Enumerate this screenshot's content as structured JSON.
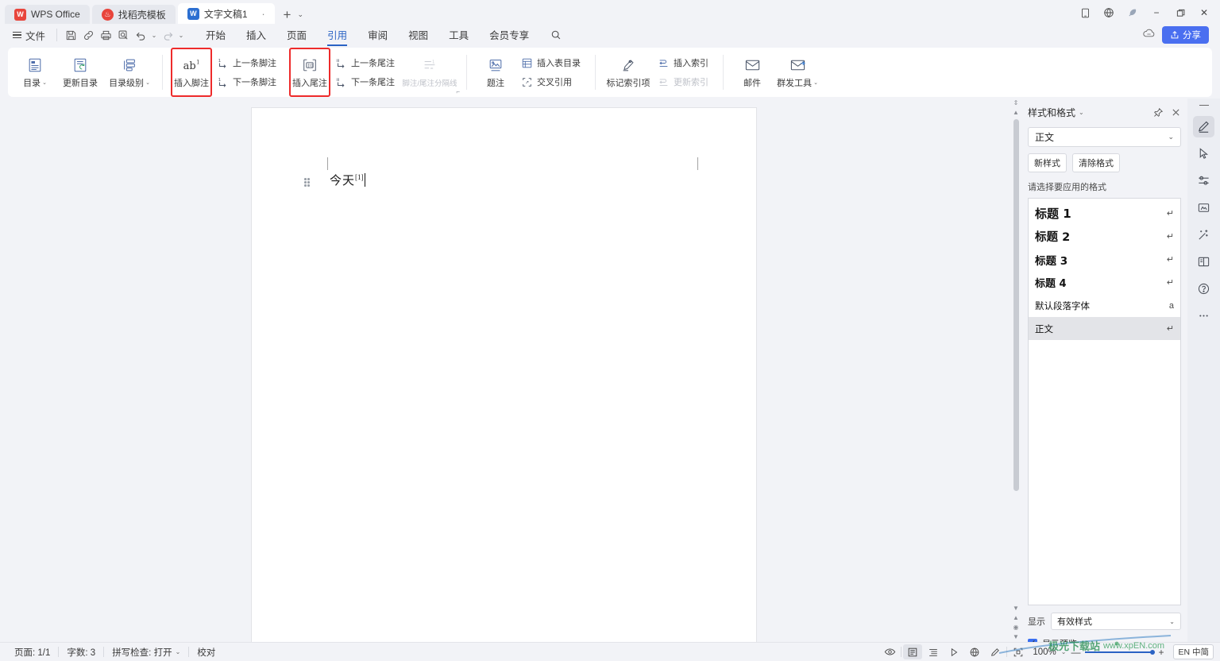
{
  "window": {
    "tabs": [
      {
        "icon": "wps-logo-icon",
        "label": "WPS Office",
        "kind": "wps"
      },
      {
        "icon": "template-icon",
        "label": "找稻壳模板",
        "kind": "tpl"
      },
      {
        "icon": "word-doc-icon",
        "label": "文字文稿1",
        "kind": "w",
        "active": true,
        "close": "✕"
      }
    ],
    "new_tab": "+",
    "new_tab_caret": "⌄",
    "right_icons": [
      "tablet-mode-icon",
      "globe-icon",
      "feather-icon"
    ],
    "minimize": "−",
    "restore": "❐",
    "close": "✕"
  },
  "menubar": {
    "file_label": "文件",
    "quick_access": [
      "save-icon",
      "link-icon",
      "print-icon",
      "print-preview-icon",
      "undo-icon",
      "redo-icon"
    ],
    "undo_caret": "⌄",
    "redo_caret": "⌄",
    "tabs": [
      {
        "label": "开始",
        "active": false
      },
      {
        "label": "插入",
        "active": false
      },
      {
        "label": "页面",
        "active": false
      },
      {
        "label": "引用",
        "active": true
      },
      {
        "label": "审阅",
        "active": false
      },
      {
        "label": "视图",
        "active": false
      },
      {
        "label": "工具",
        "active": false
      },
      {
        "label": "会员专享",
        "active": false
      }
    ],
    "search_icon": "search-icon",
    "cloud_icon": "cloud-sync-icon",
    "share_label": "分享",
    "share_icon": "share-icon",
    "share_color": "#4a6ff0"
  },
  "ribbon": {
    "highlight_color": "#ee2b2b",
    "groups": [
      {
        "name": "toc",
        "big": [
          {
            "label": "目录",
            "icon": "toc-icon",
            "caret": "⌄"
          },
          {
            "label": "更新目录",
            "icon": "update-toc-icon",
            "caret": ""
          },
          {
            "label": "目录级别",
            "icon": "toc-level-icon",
            "caret": "⌄"
          }
        ]
      },
      {
        "name": "footnote",
        "big": [
          {
            "label": "插入脚注",
            "icon": "insert-footnote-icon",
            "caret": "",
            "highlighted": true
          }
        ],
        "small": [
          {
            "label": "上一条脚注",
            "icon": "prev-footnote-icon",
            "disabled": false
          },
          {
            "label": "下一条脚注",
            "icon": "next-footnote-icon",
            "disabled": false
          }
        ]
      },
      {
        "name": "endnote",
        "big": [
          {
            "label": "插入尾注",
            "icon": "insert-endnote-icon",
            "caret": "",
            "highlighted": true
          }
        ],
        "small": [
          {
            "label": "上一条尾注",
            "icon": "prev-endnote-icon",
            "disabled": false
          },
          {
            "label": "下一条尾注",
            "icon": "next-endnote-icon",
            "disabled": false
          }
        ],
        "big2": [
          {
            "label": "脚注/尾注分隔线",
            "icon": "footnote-separator-icon",
            "caret": "",
            "disabled": true
          }
        ],
        "expander": "⌐"
      },
      {
        "name": "caption",
        "big": [
          {
            "label": "题注",
            "icon": "caption-icon",
            "caret": ""
          }
        ],
        "small": [
          {
            "label": "插入表目录",
            "icon": "insert-table-of-figures-icon",
            "disabled": false
          },
          {
            "label": "交叉引用",
            "icon": "cross-reference-icon",
            "disabled": false
          }
        ]
      },
      {
        "name": "index",
        "big": [
          {
            "label": "标记索引项",
            "icon": "mark-index-entry-icon",
            "caret": ""
          }
        ],
        "small": [
          {
            "label": "插入索引",
            "icon": "insert-index-icon",
            "disabled": false
          },
          {
            "label": "更新索引",
            "icon": "update-index-icon",
            "disabled": true
          }
        ]
      },
      {
        "name": "mail",
        "big": [
          {
            "label": "邮件",
            "icon": "mail-icon",
            "caret": ""
          },
          {
            "label": "群发工具",
            "icon": "mass-mail-icon",
            "caret": "⌄"
          }
        ]
      }
    ]
  },
  "document": {
    "text": "今天",
    "endnote_mark": "[1]",
    "paragraph_handle": "paragraph-drag-handle"
  },
  "styles_panel": {
    "title": "样式和格式",
    "title_caret": "⌄",
    "pin_icon": "pin-icon",
    "close_icon": "close-icon",
    "current_style": "正文",
    "current_style_caret": "⌄",
    "new_style_btn": "新样式",
    "clear_format_btn": "清除格式",
    "hint": "请选择要应用的格式",
    "items": [
      {
        "name": "标题",
        "num": "1",
        "mark": "↵",
        "class": "sh1",
        "selected": false
      },
      {
        "name": "标题",
        "num": "2",
        "mark": "↵",
        "class": "sh2",
        "selected": false
      },
      {
        "name": "标题",
        "num": "3",
        "mark": "↵",
        "class": "sh3",
        "selected": false
      },
      {
        "name": "标题",
        "num": "4",
        "mark": "↵",
        "class": "sh4",
        "selected": false
      },
      {
        "name": "默认段落字体",
        "num": "",
        "mark": "a",
        "class": "sbody",
        "selected": false
      },
      {
        "name": "正文",
        "num": "",
        "mark": "↵",
        "class": "sbody",
        "selected": true
      }
    ],
    "show_label": "显示",
    "show_value": "有效样式",
    "show_caret": "⌄",
    "preview_label": "显示预览",
    "preview_checked": true
  },
  "rail": {
    "items": [
      {
        "icon": "pen-highlight-icon",
        "active": true
      },
      {
        "icon": "cursor-select-icon",
        "active": false
      },
      {
        "icon": "settings-slider-icon",
        "active": false
      },
      {
        "icon": "document-tools-icon",
        "active": false
      },
      {
        "icon": "magic-wand-icon",
        "active": false
      },
      {
        "icon": "book-reader-icon",
        "active": false
      },
      {
        "icon": "help-circle-icon",
        "active": false
      },
      {
        "icon": "more-dots-icon",
        "active": false
      }
    ]
  },
  "statusbar": {
    "page_label": "页面: 1/1",
    "word_count": "字数: 3",
    "spellcheck": "拼写检查: 打开",
    "spellcheck_caret": "⌄",
    "proofread": "校对",
    "view_icons": [
      "eye-icon",
      "print-layout-icon",
      "outline-view-icon",
      "reading-layout-icon",
      "web-layout-icon",
      "edit-pen-icon",
      "focus-mode-icon"
    ],
    "zoom": "100%",
    "zoom_caret": "⌄",
    "zoom_minus": "—",
    "zoom_plus": "+",
    "language_chip": "EN 中简"
  },
  "watermark": {
    "text": "极光下载站",
    "url": "www.xpEN.com"
  }
}
